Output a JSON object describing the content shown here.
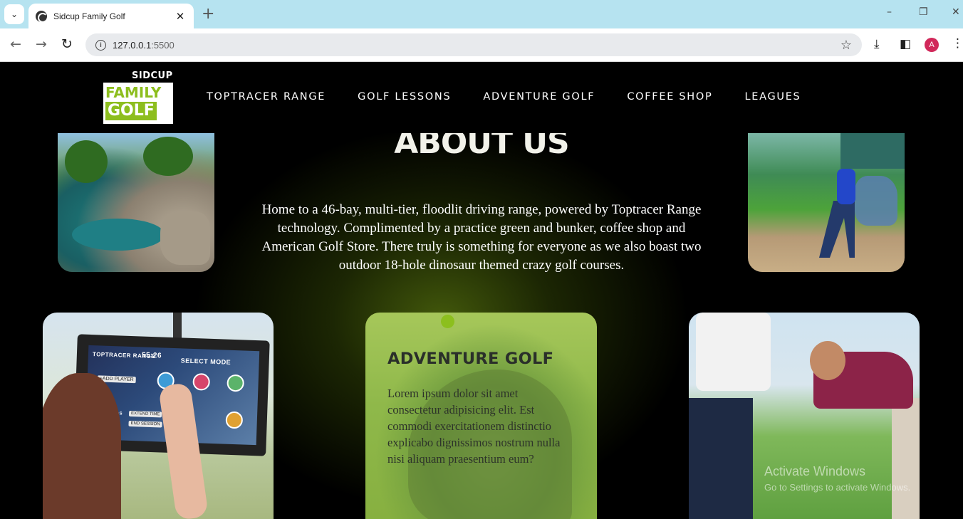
{
  "browser": {
    "tab_title": "Sidcup Family Golf",
    "tab_close": "✕",
    "new_tab": "+",
    "url": "127.0.0.1:5500",
    "url_host": "127.0.0.1",
    "url_port": ":5500",
    "avatar_letter": "A",
    "window_controls": {
      "minimize": "–",
      "restore": "❐",
      "close": "✕"
    }
  },
  "site": {
    "logo": {
      "top": "SIDCUP",
      "family": "FAMILY",
      "golf": "GOLF"
    },
    "nav": [
      "TOPTRACER RANGE",
      "GOLF LESSONS",
      "ADVENTURE GOLF",
      "COFFEE SHOP",
      "LEAGUES"
    ],
    "about": {
      "title": "ABOUT US",
      "text": "Home to a 46-bay, multi-tier, floodlit driving range, powered by Toptracer Range technology. Complimented by a practice green and bunker, coffee shop and American Golf Store. There truly is something for everyone as we also boast two outdoor 18-hole dinosaur themed crazy golf courses."
    },
    "cards": [
      {
        "name": "toptracer-screen-photo"
      },
      {
        "name": "adventure-golf",
        "title": "ADVENTURE GOLF",
        "text": "Lorem ipsum dolor sit amet consectetur adipisicing elit. Est commodi exercitationem distinctio explicabo dignissimos nostrum nulla nisi aliquam praesentium eum?"
      },
      {
        "name": "golf-lesson-photo"
      }
    ],
    "screen_ui": {
      "brand": "TOPTRACER RANGE",
      "timer": "55:26",
      "mode": "SELECT MODE",
      "add_player": "+ADD PLAYER",
      "yards": "YARDS",
      "extend": "EXTEND TIME",
      "end": "END SESSION"
    }
  },
  "watermark": {
    "line1": "Activate Windows",
    "line2": "Go to Settings to activate Windows."
  },
  "colors": {
    "accent": "#8dbe1e",
    "tabbar": "#b6e3f0",
    "page_bg": "#000000"
  }
}
